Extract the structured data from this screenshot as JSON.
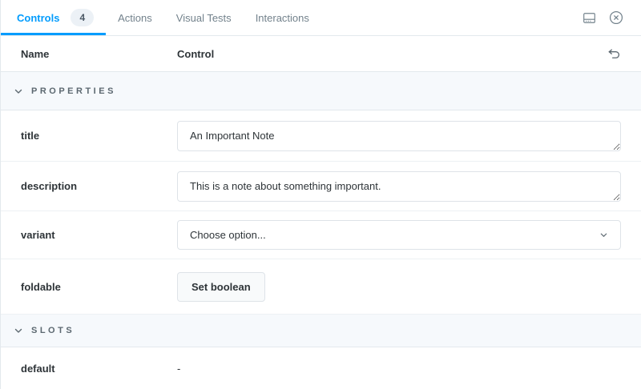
{
  "colors": {
    "accent": "#029CFD",
    "text": "#2E3438",
    "muted": "#5C6870",
    "bar_text": "#73828C",
    "border": "#E3E9ED",
    "section_bg": "#F6F9FC"
  },
  "tabs": {
    "controls": {
      "label": "Controls",
      "badge": "4"
    },
    "actions": {
      "label": "Actions"
    },
    "visual_tests": {
      "label": "Visual Tests"
    },
    "interactions": {
      "label": "Interactions"
    }
  },
  "table": {
    "header": {
      "name_col": "Name",
      "control_col": "Control"
    },
    "sections": {
      "properties": {
        "label": "PROPERTIES"
      },
      "slots": {
        "label": "SLOTS"
      }
    },
    "rows": {
      "title": {
        "name": "title",
        "value": "An Important Note"
      },
      "description": {
        "name": "description",
        "value": "This is a note about something important."
      },
      "variant": {
        "name": "variant",
        "placeholder": "Choose option..."
      },
      "foldable": {
        "name": "foldable",
        "button_label": "Set boolean"
      },
      "default": {
        "name": "default",
        "value": "-"
      }
    }
  }
}
